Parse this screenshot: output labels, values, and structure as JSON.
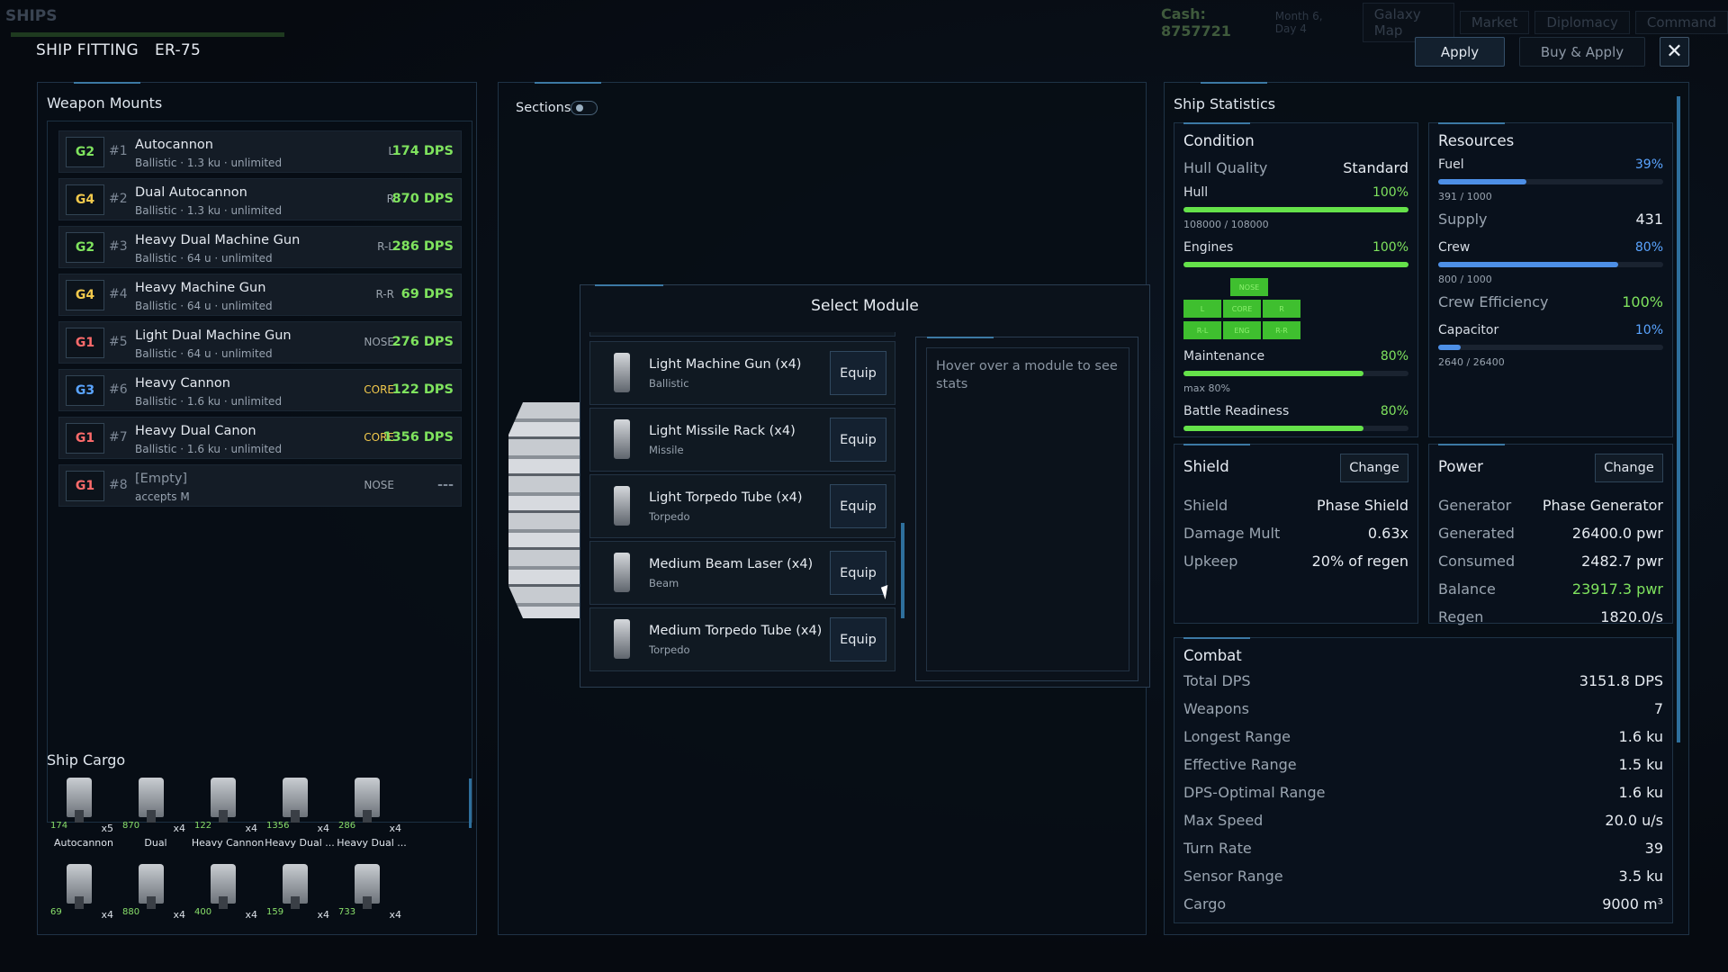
{
  "background": {
    "screen_title": "SHIPS",
    "cash": "Cash: 8757721",
    "date": "Month 6, Day 4",
    "tabs": [
      "Galaxy Map",
      "Market",
      "Diplomacy",
      "Command"
    ]
  },
  "header": {
    "title": "SHIP FITTING",
    "ship": "ER-75",
    "apply": "Apply",
    "buy_apply": "Buy & Apply",
    "close": "✕"
  },
  "weapons": {
    "title": "Weapon Mounts",
    "rows": [
      {
        "grade": "G2",
        "num": "#1",
        "name": "Autocannon",
        "sub": "Ballistic · 1.3 ku · unlimited",
        "slot": "L",
        "dps": "174 DPS",
        "grade_color": "#7fe35e",
        "slot_color": "#9aa3ad",
        "dps_color": "#7fe35e"
      },
      {
        "grade": "G4",
        "num": "#2",
        "name": "Dual Autocannon",
        "sub": "Ballistic · 1.3 ku · unlimited",
        "slot": "R",
        "dps": "870 DPS",
        "grade_color": "#f2c94c",
        "slot_color": "#9aa3ad",
        "dps_color": "#7fe35e"
      },
      {
        "grade": "G2",
        "num": "#3",
        "name": "Heavy Dual Machine Gun",
        "sub": "Ballistic · 64 u · unlimited",
        "slot": "R-L",
        "dps": "286 DPS",
        "grade_color": "#7fe35e",
        "slot_color": "#9aa3ad",
        "dps_color": "#7fe35e"
      },
      {
        "grade": "G4",
        "num": "#4",
        "name": "Heavy Machine Gun",
        "sub": "Ballistic · 64 u · unlimited",
        "slot": "R-R",
        "dps": "69 DPS",
        "grade_color": "#f2c94c",
        "slot_color": "#9aa3ad",
        "dps_color": "#7fe35e"
      },
      {
        "grade": "G1",
        "num": "#5",
        "name": "Light Dual Machine Gun",
        "sub": "Ballistic · 64 u · unlimited",
        "slot": "NOSE",
        "dps": "276 DPS",
        "grade_color": "#ff6b6b",
        "slot_color": "#9aa3ad",
        "dps_color": "#7fe35e"
      },
      {
        "grade": "G3",
        "num": "#6",
        "name": "Heavy Cannon",
        "sub": "Ballistic · 1.6 ku · unlimited",
        "slot": "CORE",
        "dps": "122 DPS",
        "grade_color": "#5aa4ff",
        "slot_color": "#f2c94c",
        "dps_color": "#7fe35e"
      },
      {
        "grade": "G1",
        "num": "#7",
        "name": "Heavy Dual Canon",
        "sub": "Ballistic · 1.6 ku · unlimited",
        "slot": "CORE",
        "dps": "1356 DPS",
        "grade_color": "#ff6b6b",
        "slot_color": "#f2c94c",
        "dps_color": "#7fe35e"
      },
      {
        "grade": "G1",
        "num": "#8",
        "name": "[Empty]",
        "sub": "accepts M",
        "slot": "NOSE",
        "dps": "---",
        "grade_color": "#ff6b6b",
        "slot_color": "#9aa3ad",
        "dps_color": "#7f8a98"
      }
    ]
  },
  "cargo": {
    "title": "Ship Cargo",
    "items": [
      {
        "num": "174",
        "count": "x5",
        "name": "Autocannon"
      },
      {
        "num": "870",
        "count": "x4",
        "name": "Dual"
      },
      {
        "num": "122",
        "count": "x4",
        "name": "Heavy Cannon"
      },
      {
        "num": "1356",
        "count": "x4",
        "name": "Heavy Dual ..."
      },
      {
        "num": "286",
        "count": "x4",
        "name": "Heavy Dual ..."
      },
      {
        "num": "69",
        "count": "x4",
        "name": ""
      },
      {
        "num": "880",
        "count": "x4",
        "name": ""
      },
      {
        "num": "400",
        "count": "x4",
        "name": ""
      },
      {
        "num": "159",
        "count": "x4",
        "name": ""
      },
      {
        "num": "733",
        "count": "x4",
        "name": ""
      }
    ]
  },
  "center": {
    "sections_label": "Sections"
  },
  "modal": {
    "title": "Select Module",
    "equip_label": "Equip",
    "modules": [
      {
        "name": "Light Machine Gun (x4)",
        "type": "Ballistic"
      },
      {
        "name": "Light Missile Rack (x4)",
        "type": "Missile"
      },
      {
        "name": "Light Torpedo Tube (x4)",
        "type": "Torpedo"
      },
      {
        "name": "Medium Beam Laser (x4)",
        "type": "Beam"
      },
      {
        "name": "Medium Torpedo Tube (x4)",
        "type": "Torpedo"
      }
    ],
    "stats_hint": "Hover over a module to see stats"
  },
  "stats": {
    "title": "Ship Statistics",
    "condition": {
      "title": "Condition",
      "hull_quality_label": "Hull Quality",
      "hull_quality": "Standard",
      "hull_label": "Hull",
      "hull_pct": "100%",
      "hull_fill": 1.0,
      "hull_sub": "108000 / 108000",
      "engines_label": "Engines",
      "engines_pct": "100%",
      "engines_fill": 1.0,
      "grid": [
        "NOSE",
        "L",
        "CORE",
        "R",
        "R-L",
        "ENG",
        "R-R"
      ],
      "maint_label": "Maintenance",
      "maint_pct": "80%",
      "maint_fill": 0.8,
      "maint_sub": "max 80%",
      "battle_label": "Battle Readiness",
      "battle_pct": "80%",
      "battle_fill": 0.8
    },
    "resources": {
      "title": "Resources",
      "fuel_label": "Fuel",
      "fuel_pct": "39%",
      "fuel_fill": 0.39,
      "fuel_sub": "391 / 1000",
      "supply_label": "Supply",
      "supply": "431",
      "crew_label": "Crew",
      "crew_pct": "80%",
      "crew_fill": 0.8,
      "crew_sub": "800 / 1000",
      "crew_eff_label": "Crew Efficiency",
      "crew_eff": "100%",
      "cap_label": "Capacitor",
      "cap_pct": "10%",
      "cap_fill": 0.1,
      "cap_sub": "2640 / 26400"
    },
    "shield": {
      "title": "Shield",
      "change": "Change",
      "rows": [
        {
          "k": "Shield",
          "v": "Phase Shield"
        },
        {
          "k": "Damage Mult",
          "v": "0.63x"
        },
        {
          "k": "Upkeep",
          "v": "20% of regen"
        }
      ]
    },
    "power": {
      "title": "Power",
      "change": "Change",
      "rows": [
        {
          "k": "Generator",
          "v": "Phase Generator"
        },
        {
          "k": "Generated",
          "v": "26400.0 pwr"
        },
        {
          "k": "Consumed",
          "v": "2482.7 pwr"
        },
        {
          "k": "Balance",
          "v": "23917.3 pwr"
        },
        {
          "k": "Regen",
          "v": "1820.0/s"
        }
      ]
    },
    "combat": {
      "title": "Combat",
      "rows": [
        {
          "k": "Total DPS",
          "v": "3151.8 DPS"
        },
        {
          "k": "Weapons",
          "v": "7"
        },
        {
          "k": "Longest Range",
          "v": "1.6 ku"
        },
        {
          "k": "Effective Range",
          "v": "1.5 ku"
        },
        {
          "k": "DPS-Optimal Range",
          "v": "1.6 ku"
        },
        {
          "k": "Max Speed",
          "v": "20.0 u/s"
        },
        {
          "k": "Turn Rate",
          "v": "39"
        },
        {
          "k": "Sensor Range",
          "v": "3.5 ku"
        },
        {
          "k": "Cargo",
          "v": "9000 m³"
        }
      ]
    },
    "colors": {
      "green": "#7fe35e",
      "blue": "#5aa4ff"
    }
  }
}
